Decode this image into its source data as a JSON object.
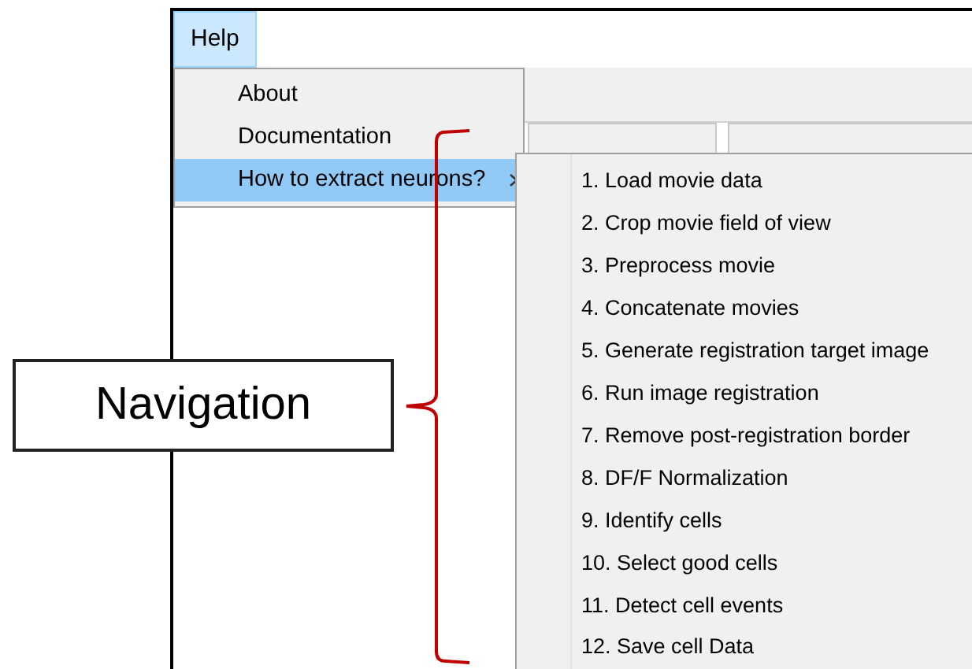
{
  "menu_bar": [
    {
      "label": "Help",
      "selected": true
    }
  ],
  "help_menu": [
    {
      "label": "About",
      "selected": false,
      "has_submenu": false
    },
    {
      "label": "Documentation",
      "selected": false,
      "has_submenu": false
    },
    {
      "label": "How to extract neurons?",
      "selected": true,
      "has_submenu": true
    }
  ],
  "submenu": [
    {
      "label": "1. Load movie data"
    },
    {
      "label": "2. Crop movie field of view"
    },
    {
      "label": "3. Preprocess movie"
    },
    {
      "label": "4. Concatenate movies"
    },
    {
      "label": "5. Generate registration target image"
    },
    {
      "label": "6. Run image registration"
    },
    {
      "label": "7. Remove post-registration border"
    },
    {
      "label": "8. DF/F Normalization"
    },
    {
      "label": "9. Identify cells"
    },
    {
      "label": "10. Select good cells"
    },
    {
      "label": "11. Detect cell events"
    },
    {
      "label": "12. Save cell Data"
    }
  ],
  "annotation": {
    "label": "Navigation"
  }
}
